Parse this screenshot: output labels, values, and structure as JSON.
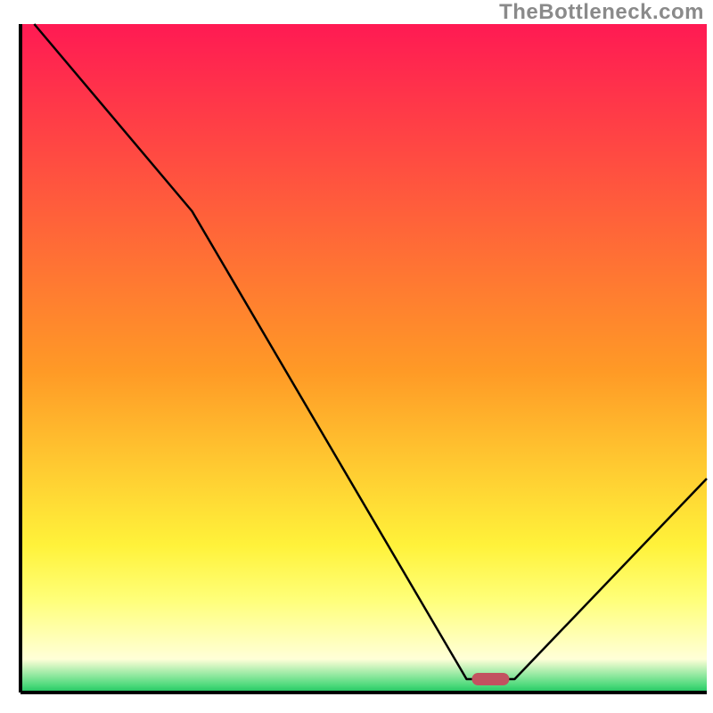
{
  "watermark": "TheBottleneck.com",
  "chart_data": {
    "type": "line",
    "title": "",
    "xlabel": "",
    "ylabel": "",
    "xlim": [
      0,
      100
    ],
    "ylim": [
      0,
      100
    ],
    "x": [
      2,
      25,
      65,
      72,
      100
    ],
    "values": [
      100,
      72,
      2,
      2,
      32
    ],
    "marker": {
      "x": 68.5,
      "y": 2
    },
    "background": {
      "type": "vertical-gradient",
      "stops": [
        {
          "position": 0.0,
          "color": "#ff1a53"
        },
        {
          "position": 0.52,
          "color": "#ff9a26"
        },
        {
          "position": 0.78,
          "color": "#fff23a"
        },
        {
          "position": 0.86,
          "color": "#ffff78"
        },
        {
          "position": 0.95,
          "color": "#ffffd8"
        },
        {
          "position": 0.99,
          "color": "#4ad97a"
        },
        {
          "position": 1.0,
          "color": "#1fc25f"
        }
      ]
    },
    "axis_color": "#000000",
    "line_color": "#000000",
    "marker_color": "#c25260"
  }
}
